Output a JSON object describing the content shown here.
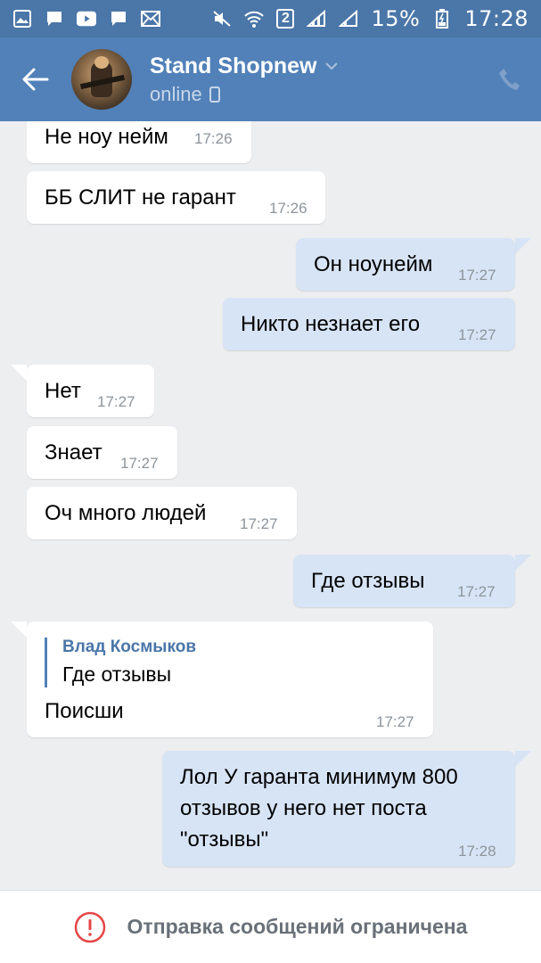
{
  "status_bar": {
    "badge": "2",
    "battery": "15%",
    "time": "17:28",
    "icons_left": [
      "gallery-icon",
      "message-icon",
      "youtube-icon",
      "chat-icon",
      "mail-icon"
    ],
    "icons_right": [
      "mute-icon",
      "wifi-icon",
      "sim-badge",
      "signal-icon",
      "signal-icon",
      "battery-icon"
    ]
  },
  "header": {
    "title": "Stand Shopnew",
    "status": "online",
    "accent": "#5181b8"
  },
  "messages": [
    {
      "dir": "in",
      "text": "Не ноу нейм",
      "time": "17:26"
    },
    {
      "dir": "in",
      "text": "ББ СЛИТ не гарант",
      "time": "17:26"
    },
    {
      "dir": "out",
      "text": "Он ноунейм",
      "time": "17:27"
    },
    {
      "dir": "out",
      "text": "Никто незнает его",
      "time": "17:27"
    },
    {
      "dir": "in",
      "text": "Нет",
      "time": "17:27"
    },
    {
      "dir": "in",
      "text": "Знает",
      "time": "17:27"
    },
    {
      "dir": "in",
      "text": "Оч много людей",
      "time": "17:27"
    },
    {
      "dir": "out",
      "text": "Где отзывы",
      "time": "17:27"
    },
    {
      "dir": "in",
      "reply_author": "Влад Космыков",
      "reply_text": "Где отзывы",
      "text": "Поисши",
      "time": "17:27"
    },
    {
      "dir": "out",
      "lines": [
        "Лол У гаранта минимум 800",
        "отзывов у него нет поста",
        "\"отзывы\""
      ],
      "time": "17:28"
    }
  ],
  "bottom_bar": {
    "text": "Отправка сообщений ограничена",
    "icon": "warning-icon"
  }
}
